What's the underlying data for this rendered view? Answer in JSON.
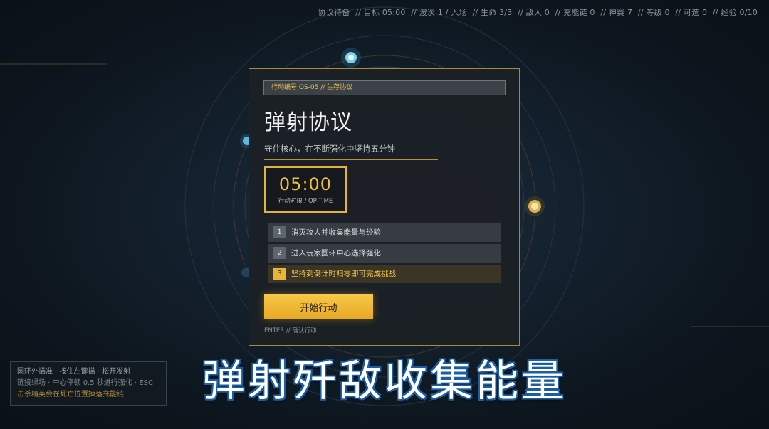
{
  "hud": {
    "status": "协议待备",
    "target": "// 目标 05:00",
    "wave": "// 波次 1 / 入场",
    "lives": "// 生命 3/3",
    "enemies": "// 敌人 0",
    "charge": "// 充能链 0",
    "fury": "// 神赛 7",
    "level": "// 等级 0",
    "options": "// 可选 0",
    "exp": "// 经验 0/10"
  },
  "panel": {
    "op_code": "行动编号 OS-05 // 生存协议",
    "title": "弹射协议",
    "subtitle": "守住核心，在不断强化中坚持五分钟",
    "timer_value": "05:00",
    "timer_label": "行动时限 / OP-TIME",
    "steps": [
      {
        "num": "1",
        "label": "消灭攻人并收集能量与经验"
      },
      {
        "num": "2",
        "label": "进入玩家圆环中心选择强化"
      },
      {
        "num": "3",
        "label": "坚持到倒计时归零即可完成挑战"
      }
    ],
    "start_label": "开始行动",
    "enter_hint": "ENTER // 确认行动"
  },
  "tips": {
    "line1": "圆环外描准 · 按住左键描 · 松开发射",
    "line2": "链接绿场 · 中心停顿 0.5 秒进行强化 · ESC",
    "line3": "击杀精英会在死亡位置掉落充能链"
  },
  "caption": "弹射歼敌收集能量",
  "colors": {
    "accent": "#f0bf3e",
    "panel_border": "#a8883a",
    "caption_outline": "#1d5ea3"
  }
}
